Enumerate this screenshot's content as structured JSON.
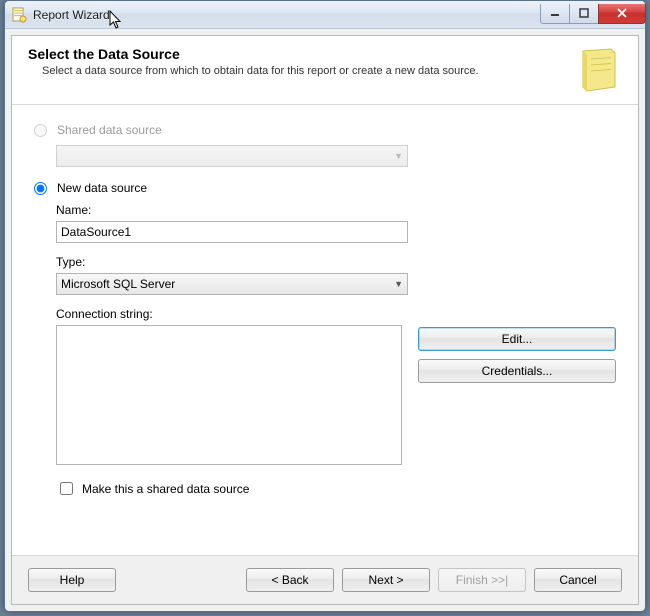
{
  "window": {
    "title": "Report Wizard"
  },
  "header": {
    "title": "Select the Data Source",
    "subtitle": "Select a data source from which to obtain data for this report or create a new data source."
  },
  "options": {
    "shared": {
      "label": "Shared data source",
      "selected_value": ""
    },
    "new": {
      "label": "New data source"
    }
  },
  "fields": {
    "name_label": "Name:",
    "name_value": "DataSource1",
    "type_label": "Type:",
    "type_value": "Microsoft SQL Server",
    "conn_label": "Connection string:",
    "conn_value": ""
  },
  "side": {
    "edit": "Edit...",
    "credentials": "Credentials..."
  },
  "shared_check": {
    "label": "Make this a shared data source"
  },
  "footer": {
    "help": "Help",
    "back": "< Back",
    "next": "Next >",
    "finish": "Finish >>|",
    "cancel": "Cancel"
  }
}
